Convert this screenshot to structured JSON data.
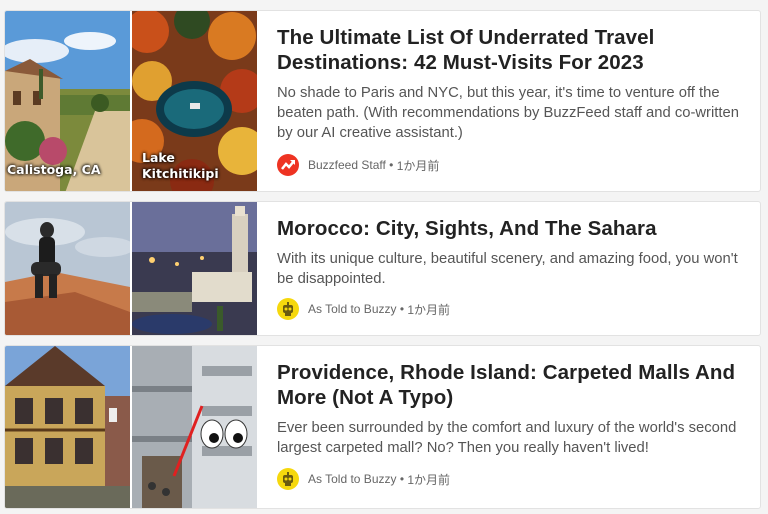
{
  "articles": [
    {
      "title": "The Ultimate List Of Underrated Travel Destinations: 42 Must-Visits For 2023",
      "description": "No shade to Paris and NYC, but this year, it's time to venture off the beaten path. (With recommendations by BuzzFeed staff and co-written by our AI creative assistant.)",
      "author": "Buzzfeed Staff",
      "time": "1か月前",
      "image_captions": [
        "Calistoga, CA",
        "Lake Kitchitikipi"
      ],
      "avatar_icon": "buzzfeed-trending-icon"
    },
    {
      "title": "Morocco: City, Sights, And The Sahara",
      "description": "With its unique culture, beautiful scenery, and amazing food, you won't be disappointed.",
      "author": "As Told to Buzzy",
      "time": "1か月前",
      "avatar_icon": "buzzy-robot-icon"
    },
    {
      "title": "Providence, Rhode Island: Carpeted Malls And More (Not A Typo)",
      "description": "Ever been surrounded by the comfort and luxury of the world's second largest carpeted mall? No? Then you really haven't lived!",
      "author": "As Told to Buzzy",
      "time": "1か月前",
      "avatar_icon": "buzzy-robot-icon"
    }
  ],
  "separator": " • "
}
